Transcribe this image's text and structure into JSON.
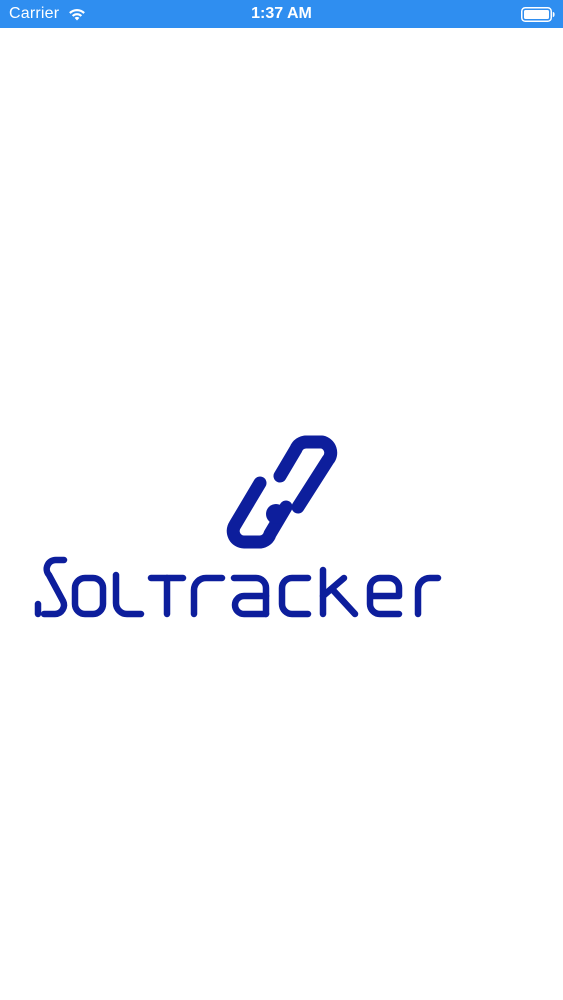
{
  "status_bar": {
    "carrier": "Carrier",
    "time": "1:37 AM",
    "background_color": "#2f8ef0",
    "icons": [
      "wifi-icon",
      "battery-icon"
    ]
  },
  "splash": {
    "logo_text": "SOLTRACKER",
    "logo_icon": "chain-link-icon",
    "brand_color": "#0d1e9c",
    "background_color": "#ffffff"
  }
}
